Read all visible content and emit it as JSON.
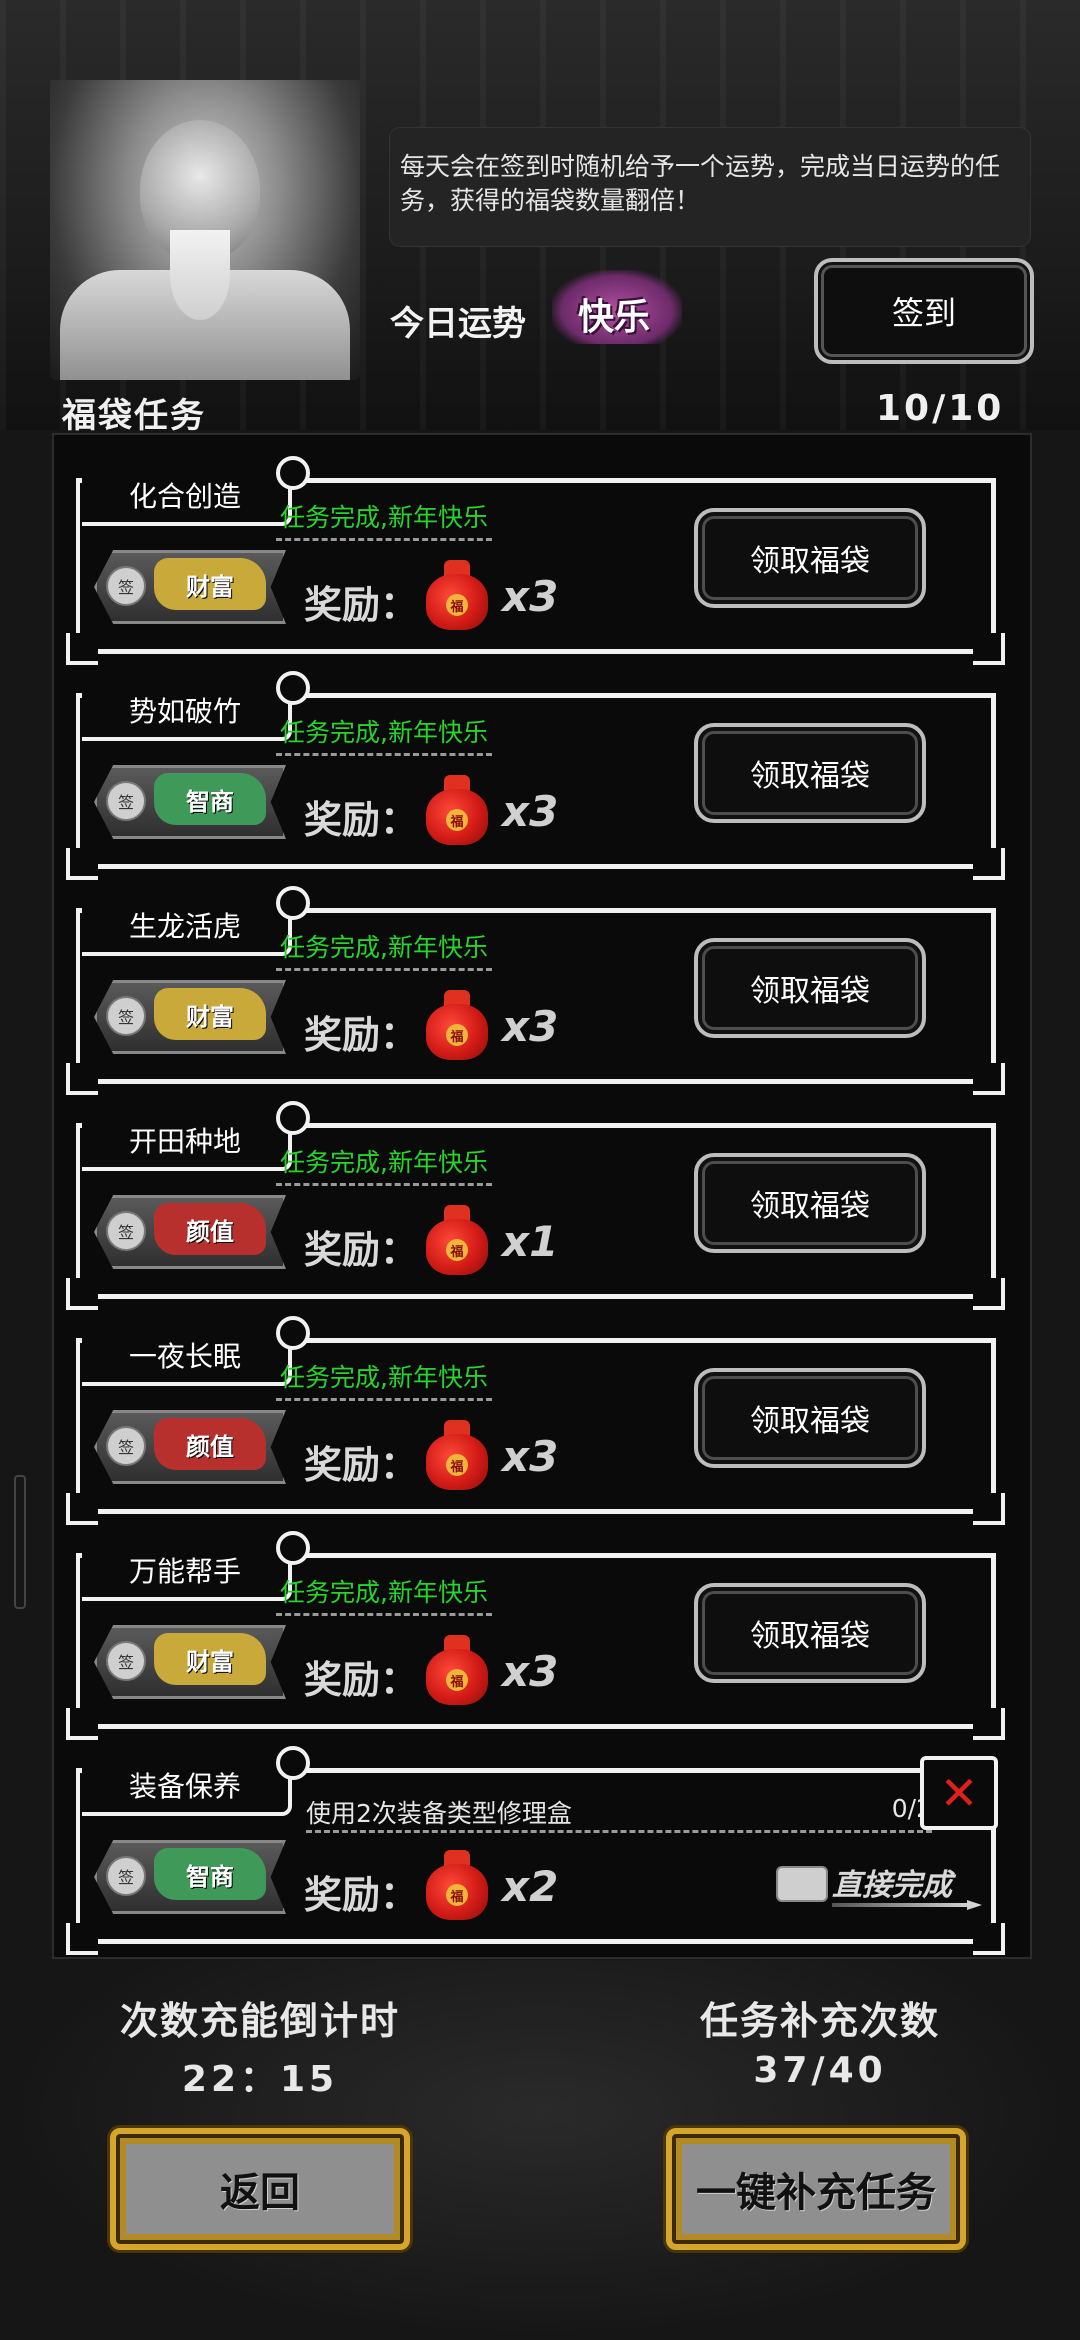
{
  "header": {
    "speech": "每天会在签到时随机给予一个运势，完成当日运势的任务，获得的福袋数量翻倍！",
    "fortune_label": "今日运势",
    "fortune_value": "快乐",
    "signin_label": "签到"
  },
  "section": {
    "title": "福袋任务",
    "count": "10/10"
  },
  "reward_label": "奖励：",
  "tasks": [
    {
      "name": "化合创造",
      "tag": "财富",
      "tag_color": "#c9a93a",
      "status": "任务完成,新年快乐",
      "qty": "x3",
      "action": "领取福袋"
    },
    {
      "name": "势如破竹",
      "tag": "智商",
      "tag_color": "#3f9a5a",
      "status": "任务完成,新年快乐",
      "qty": "x3",
      "action": "领取福袋"
    },
    {
      "name": "生龙活虎",
      "tag": "财富",
      "tag_color": "#c9a93a",
      "status": "任务完成,新年快乐",
      "qty": "x3",
      "action": "领取福袋"
    },
    {
      "name": "开田种地",
      "tag": "颜值",
      "tag_color": "#b8302d",
      "status": "任务完成,新年快乐",
      "qty": "x1",
      "action": "领取福袋"
    },
    {
      "name": "一夜长眠",
      "tag": "颜值",
      "tag_color": "#b8302d",
      "status": "任务完成,新年快乐",
      "qty": "x3",
      "action": "领取福袋"
    },
    {
      "name": "万能帮手",
      "tag": "财富",
      "tag_color": "#c9a93a",
      "status": "任务完成,新年快乐",
      "qty": "x3",
      "action": "领取福袋"
    },
    {
      "name": "装备保养",
      "tag": "智商",
      "tag_color": "#3f9a5a",
      "desc": "使用2次装备类型修理盒",
      "progress": "0/2",
      "qty": "x2",
      "action": "直接完成",
      "close": "✕"
    }
  ],
  "seal_char": "签",
  "bag_char": "福",
  "footer": {
    "countdown_title": "次数充能倒计时",
    "countdown_value": "22：15",
    "refill_title": "任务补充次数",
    "refill_value": "37/40",
    "back_label": "返回",
    "refill_button_label": "一键补充任务"
  }
}
